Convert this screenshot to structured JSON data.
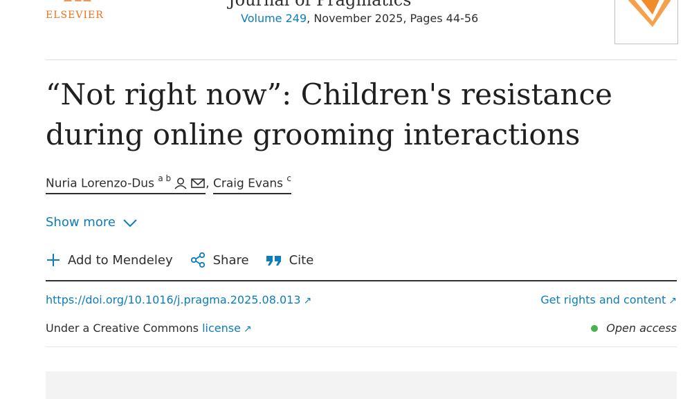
{
  "header": {
    "publisher": "ELSEVIER",
    "journal_partial": "Journal of Pragmatics",
    "volume_link": "Volume 249",
    "issue_rest": ", November 2025, Pages 44-56"
  },
  "article": {
    "title": "“Not right now”: Children's resistance during online grooming interactions",
    "authors": [
      {
        "name": "Nuria Lorenzo-Dus",
        "affil": "a b"
      },
      {
        "name": "Craig Evans",
        "affil": "c"
      }
    ],
    "author_sep": ",",
    "show_more": "Show more"
  },
  "actions": {
    "mendeley": "Add to Mendeley",
    "share": "Share",
    "cite": "Cite"
  },
  "links": {
    "doi": "https://doi.org/10.1016/j.pragma.2025.08.013",
    "rights": "Get rights and content",
    "license_prefix": "Under a Creative Commons",
    "license_link": "license",
    "open_access": "Open access",
    "external_arrow": "↗"
  },
  "colors": {
    "link": "#0c7dbb",
    "brand": "#e9711c",
    "open_access_dot": "#4caf50"
  },
  "icons": [
    "person-icon",
    "mail-icon",
    "chevron-down-icon",
    "plus-icon",
    "share-icon",
    "quote-icon",
    "external-link-icon"
  ]
}
